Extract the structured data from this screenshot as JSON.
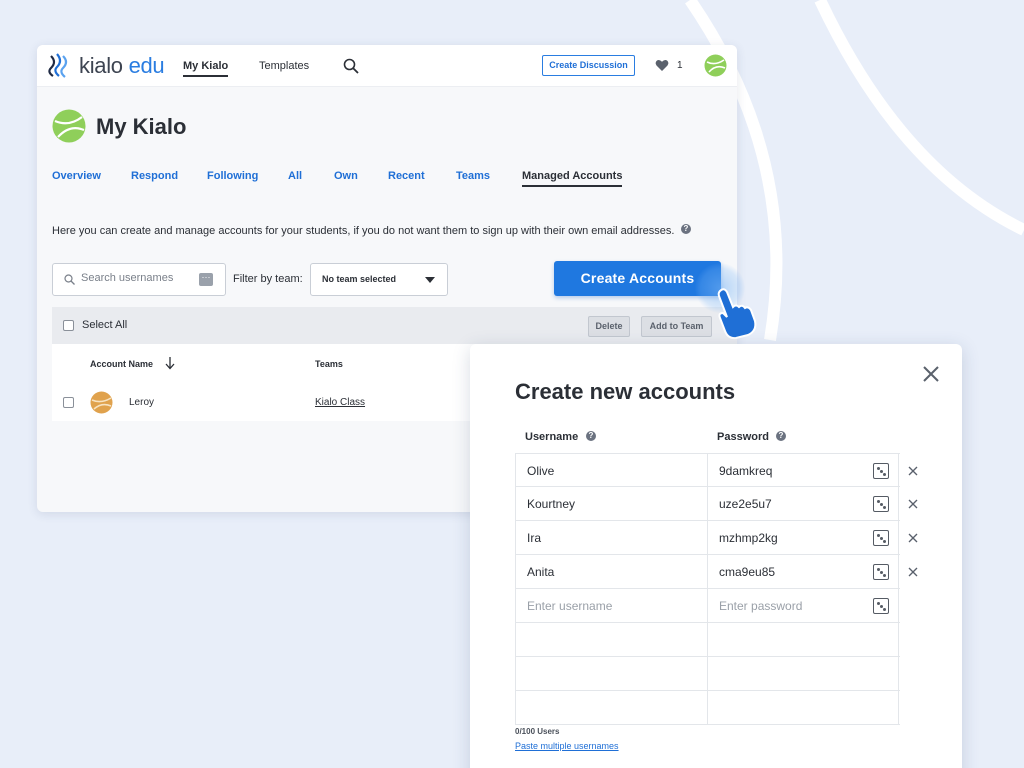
{
  "nav": {
    "logo_word": "kialo",
    "logo_suffix": "edu",
    "my_kialo": "My Kialo",
    "templates": "Templates",
    "create_discussion": "Create Discussion",
    "likes_count": "1"
  },
  "page": {
    "title": "My Kialo",
    "tabs": [
      "Overview",
      "Respond",
      "Following",
      "All",
      "Own",
      "Recent",
      "Teams",
      "Managed Accounts"
    ],
    "active_tab": "Managed Accounts",
    "intro": "Here you can create and manage accounts for your students, if you do not want them to sign up with their own email addresses."
  },
  "toolbar": {
    "search_placeholder": "Search usernames",
    "filter_label": "Filter by team:",
    "team_value": "No team selected",
    "create_accounts": "Create Accounts"
  },
  "bulk": {
    "select_all": "Select All",
    "delete": "Delete",
    "add_to_team": "Add to Team"
  },
  "table": {
    "col_account": "Account Name",
    "col_teams": "Teams",
    "rows": [
      {
        "name": "Leroy",
        "team": "Kialo Class"
      }
    ]
  },
  "modal": {
    "title": "Create new accounts",
    "col_username": "Username",
    "col_password": "Password",
    "entries": [
      {
        "username": "Olive",
        "password": "9damkreq"
      },
      {
        "username": "Kourtney",
        "password": "uze2e5u7"
      },
      {
        "username": "Ira",
        "password": "mzhmp2kg"
      },
      {
        "username": "Anita",
        "password": "cma9eu85"
      }
    ],
    "username_placeholder": "Enter username",
    "password_placeholder": "Enter password",
    "user_count": "0/100 Users",
    "paste_link": "Paste multiple usernames"
  },
  "colors": {
    "accent": "#1f78e0",
    "background": "#e8eef9",
    "text": "#2b2f36"
  },
  "icons": [
    "kialo-logo-icon",
    "search-icon",
    "heart-icon",
    "avatar-icon",
    "help-icon",
    "dots-icon",
    "chevron-down-icon",
    "sort-arrow-icon",
    "hand-cursor-icon",
    "close-icon",
    "dice-icon",
    "remove-x-icon"
  ]
}
